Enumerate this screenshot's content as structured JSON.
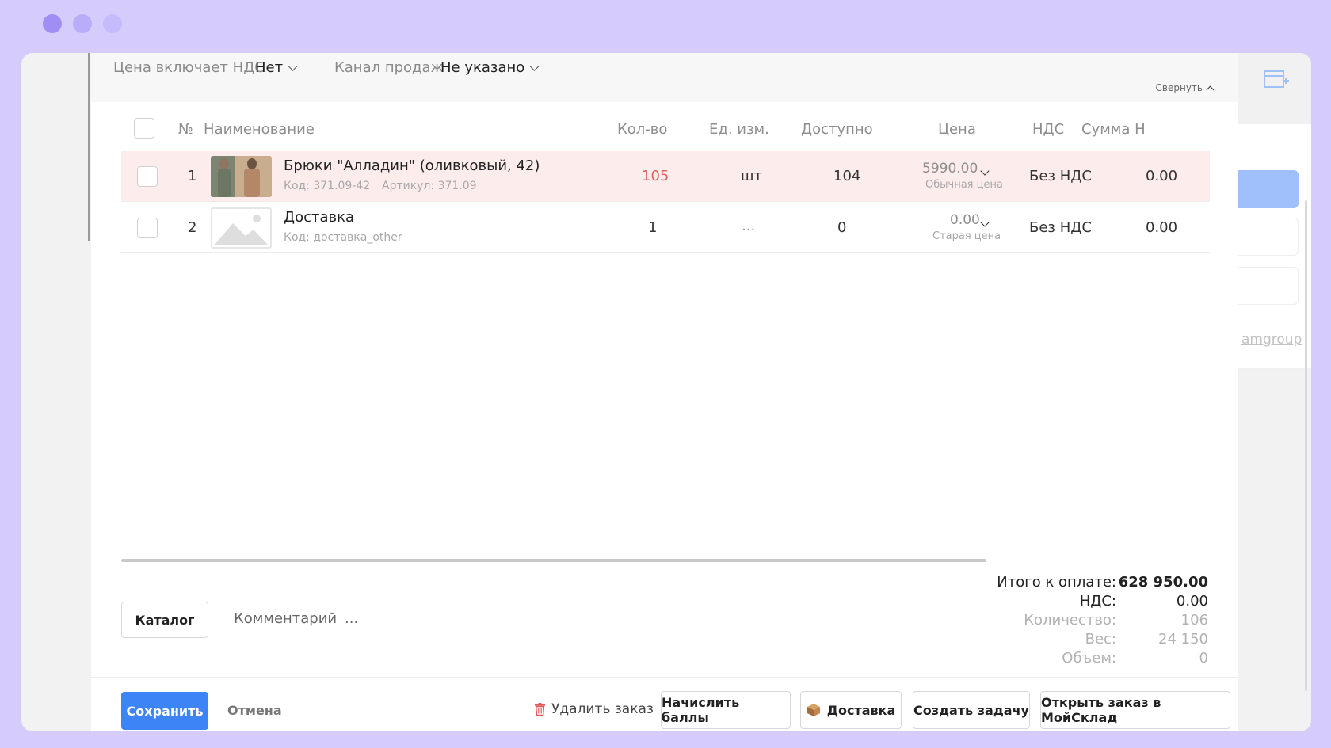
{
  "topbar": {
    "vat_label": "Цена включает НДС",
    "vat_value": "Нет",
    "channel_label": "Канал продаж",
    "channel_value": "Не указано",
    "collapse_label": "Свернуть"
  },
  "table": {
    "headers": [
      "№",
      "Наименование",
      "Кол-во",
      "Ед. изм.",
      "Доступно",
      "Цена",
      "НДС",
      "Сумма Н"
    ],
    "rows": [
      {
        "index": "1",
        "name": "Брюки \"Алладин\" (оливковый, 42)",
        "code": "Код: 371.09-42",
        "article": "Артикул: 371.09",
        "qty": "105",
        "unit": "шт",
        "available": "104",
        "price": "5990.00",
        "price_type": "Обычная цена",
        "vat": "Без НДС",
        "sum": "0.00",
        "highlight": true
      },
      {
        "index": "2",
        "name": "Доставка",
        "code": "Код: доставка_other",
        "qty": "1",
        "unit": "...",
        "available": "0",
        "price": "0.00",
        "price_type": "Старая цена",
        "vat": "Без НДС",
        "sum": "0.00",
        "highlight": false
      }
    ]
  },
  "actions": {
    "catalog": "Каталог",
    "comment": "Комментарий",
    "more": "..."
  },
  "totals": {
    "to_pay_label": "Итого к оплате:",
    "to_pay_value": "628 950.00",
    "vat_label": "НДС:",
    "vat_value": "0.00",
    "qty_label": "Количество:",
    "qty_value": "106",
    "weight_label": "Вес:",
    "weight_value": "24 150",
    "volume_label": "Объем:",
    "volume_value": "0"
  },
  "footer": {
    "save": "Сохранить",
    "cancel": "Отмена",
    "delete": "Удалить заказ",
    "bonus": "Начислить баллы",
    "delivery": "Доставка",
    "task": "Создать задачу",
    "open_ms": "Открыть заказ в МойСклад"
  },
  "background": {
    "link_fragment": "amgroup"
  },
  "colors": {
    "accent": "#3d84f7",
    "highlight_row": "#fdecec",
    "qty_error": "#e06060",
    "frame": "#d6ccfb"
  }
}
